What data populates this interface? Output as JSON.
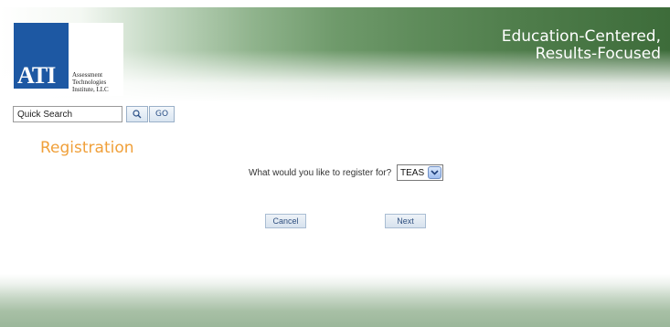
{
  "header": {
    "logo": {
      "mark": "ATI",
      "company_line1": "Assessment",
      "company_line2": "Technologies",
      "company_line3": "Institute, LLC"
    },
    "tagline_line1": "Education-Centered,",
    "tagline_line2": "Results-Focused"
  },
  "search": {
    "value": "Quick Search",
    "go_label": "GO",
    "search_icon": "search-icon"
  },
  "main": {
    "title": "Registration",
    "prompt": "What would you like to register for?",
    "select_value": "TEAS",
    "cancel_label": "Cancel",
    "next_label": "Next"
  },
  "colors": {
    "title_orange": "#f0a03a",
    "logo_blue": "#1d58a3",
    "header_green": "#5f8c5b"
  }
}
